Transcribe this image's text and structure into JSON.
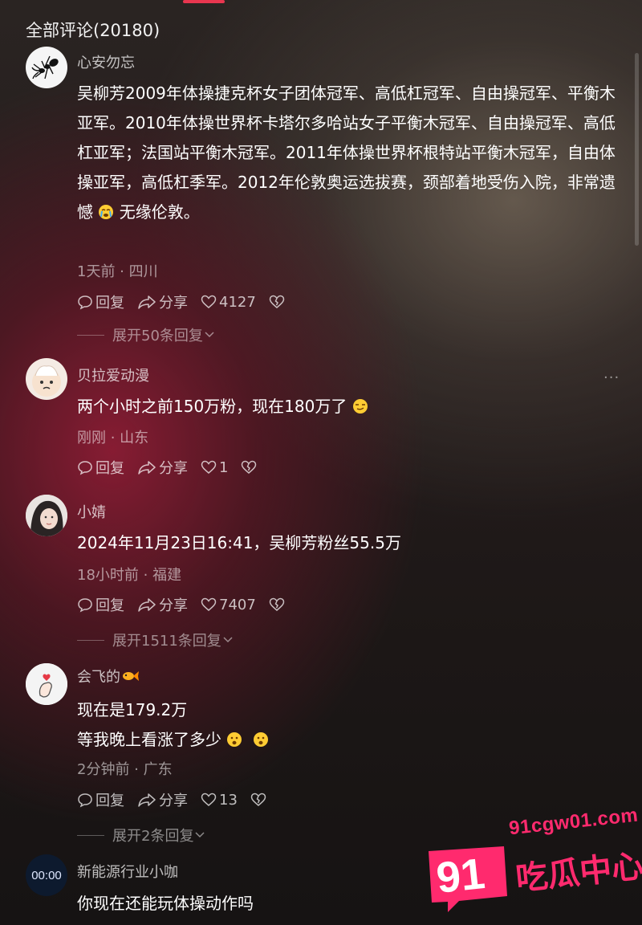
{
  "header": {
    "title": "全部评论(20180)"
  },
  "watermark": {
    "url": "91cgw01.com",
    "badge": "91",
    "name": "吃瓜中心"
  },
  "labels": {
    "reply": "回复",
    "share": "分享"
  },
  "comments": [
    {
      "username": "心安勿忘",
      "text": "吴柳芳2009年体操捷克杯女子团体冠军、高低杠冠军、自由操冠军、平衡木亚军。2010年体操世界杯卡塔尔多哈站女子平衡木冠军、自由操冠军、高低杠亚军；法国站平衡木冠军。2011年体操世界杯根特站平衡木冠军，自由体操亚军，高低杠季军。2012年伦敦奥运选拔赛，颈部着地受伤入院，非常遗憾",
      "text_tail": "无缘伦敦。",
      "meta": "1天前 · 四川",
      "likes": "4127",
      "expand": "展开50条回复"
    },
    {
      "username": "贝拉爱动漫",
      "text": "两个小时之前150万粉，现在180万了",
      "meta": "刚刚 · 山东",
      "likes": "1"
    },
    {
      "username": "小婧",
      "text": "2024年11月23日16:41，吴柳芳粉丝55.5万",
      "meta": "18小时前 · 福建",
      "likes": "7407",
      "expand": "展开1511条回复"
    },
    {
      "username": "会飞的",
      "text_line1": "现在是179.2万",
      "text_line2": "等我晚上看涨了多少",
      "meta": "2分钟前 · 广东",
      "likes": "13",
      "expand": "展开2条回复"
    },
    {
      "username": "新能源行业小咖",
      "avatar_text": "00:00",
      "text": "你现在还能玩体操动作吗"
    }
  ]
}
